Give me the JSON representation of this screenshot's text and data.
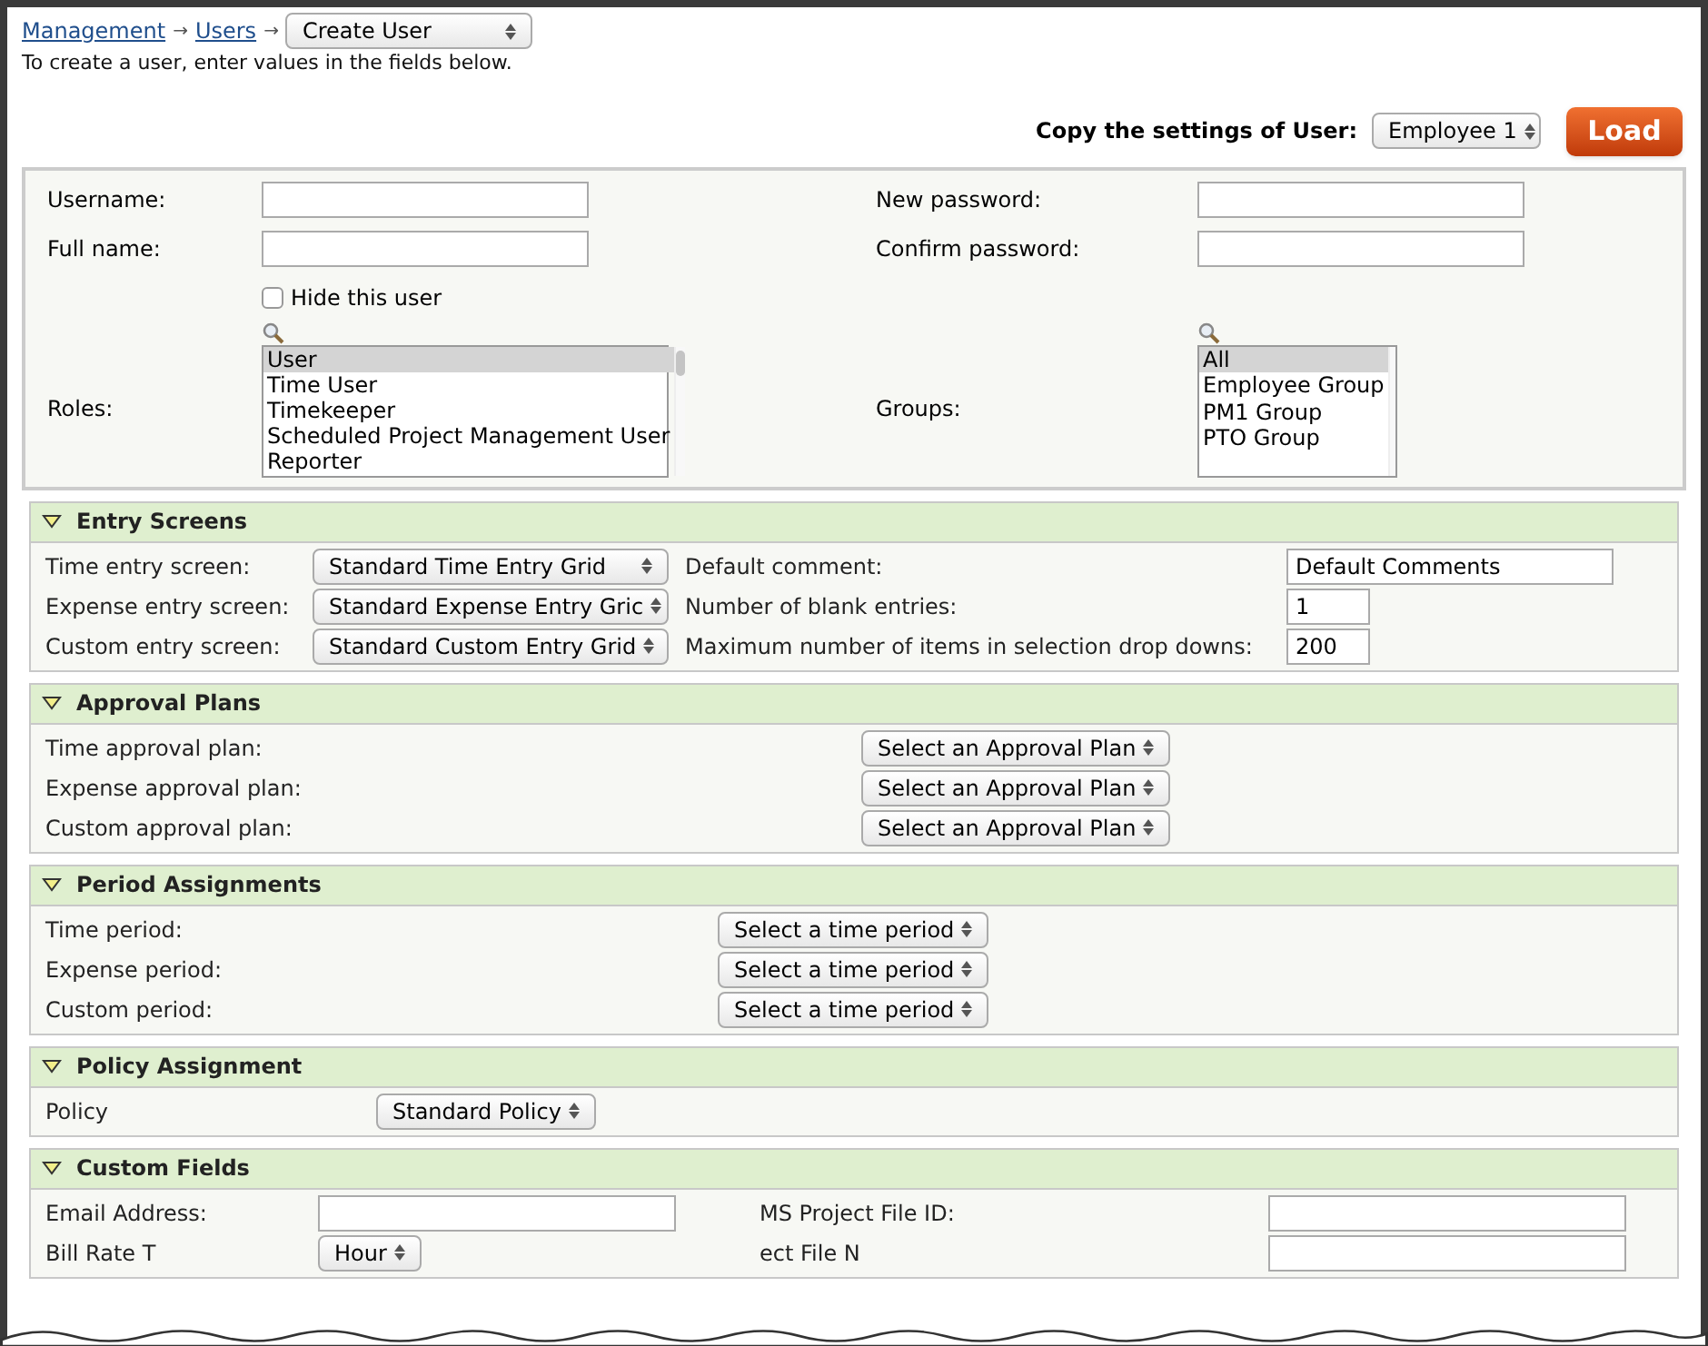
{
  "breadcrumb": {
    "links": [
      "Management",
      "Users"
    ],
    "separator": "→",
    "current": "Create User"
  },
  "intro": "To create a user, enter values in the fields below.",
  "copy_settings": {
    "label": "Copy the settings of User:",
    "value": "Employee 1",
    "button": "Load"
  },
  "user_form": {
    "username": {
      "label": "Username:"
    },
    "full_name": {
      "label": "Full name:"
    },
    "new_password": {
      "label": "New password:"
    },
    "confirm_password": {
      "label": "Confirm password:"
    },
    "hide_user": {
      "label": "Hide this user",
      "checked": false
    },
    "roles": {
      "label": "Roles:",
      "items": [
        {
          "label": "User",
          "selected": true
        },
        {
          "label": "Time User",
          "selected": false
        },
        {
          "label": "Timekeeper",
          "selected": false
        },
        {
          "label": "Scheduled Project Management User",
          "selected": false
        },
        {
          "label": "Reporter",
          "selected": false
        }
      ]
    },
    "groups": {
      "label": "Groups:",
      "items": [
        {
          "label": "All",
          "selected": true
        },
        {
          "label": "Employee Group",
          "selected": false
        },
        {
          "label": "PM1 Group",
          "selected": false
        },
        {
          "label": "PTO Group",
          "selected": false
        }
      ]
    }
  },
  "sections": [
    {
      "title": "Entry Screens",
      "expanded": true,
      "rows": [
        [
          {
            "label": "Time entry screen:",
            "kind": "select",
            "value": "Standard Time Entry Grid"
          },
          {
            "label": "Default comment:",
            "kind": "text",
            "value": "Default Comments"
          }
        ],
        [
          {
            "label": "Expense entry screen:",
            "kind": "select",
            "value": "Standard Expense Entry Gric"
          },
          {
            "label": "Number of blank entries:",
            "kind": "text",
            "value": "1"
          }
        ],
        [
          {
            "label": "Custom entry screen:",
            "kind": "select",
            "value": "Standard Custom Entry Grid"
          },
          {
            "label": "Maximum number of items in selection drop downs:",
            "kind": "text",
            "value": "200"
          }
        ]
      ]
    },
    {
      "title": "Approval Plans",
      "expanded": true,
      "rows": [
        [
          {
            "label": "Time approval plan:",
            "kind": "select",
            "value": "Select an Approval Plan"
          }
        ],
        [
          {
            "label": "Expense approval plan:",
            "kind": "select",
            "value": "Select an Approval Plan"
          }
        ],
        [
          {
            "label": "Custom approval plan:",
            "kind": "select",
            "value": "Select an Approval Plan"
          }
        ]
      ]
    },
    {
      "title": "Period Assignments",
      "expanded": true,
      "rows": [
        [
          {
            "label": "Time period:",
            "kind": "select",
            "value": "Select a time period"
          }
        ],
        [
          {
            "label": "Expense period:",
            "kind": "select",
            "value": "Select a time period"
          }
        ],
        [
          {
            "label": "Custom period:",
            "kind": "select",
            "value": "Select a time period"
          }
        ]
      ]
    },
    {
      "title": "Policy Assignment",
      "expanded": true,
      "rows": [
        [
          {
            "label": "Policy",
            "kind": "select",
            "value": "Standard Policy"
          }
        ]
      ]
    },
    {
      "title": "Custom Fields",
      "expanded": true,
      "rows": [
        [
          {
            "label": "Email Address:",
            "kind": "text"
          },
          {
            "label": "MS Project File ID:",
            "kind": "text"
          }
        ],
        [
          {
            "label": "Bill Rate T",
            "kind": "select",
            "value": "Hour"
          },
          {
            "label": "ect File N",
            "kind": "text"
          }
        ]
      ]
    }
  ]
}
